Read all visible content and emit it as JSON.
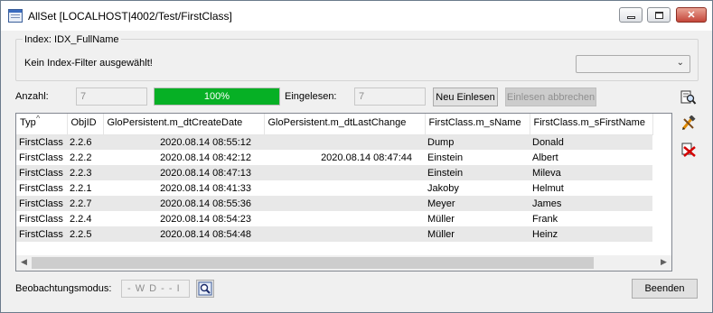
{
  "window": {
    "title": "AllSet [LOCALHOST|4002/Test/FirstClass]"
  },
  "index": {
    "legend": "Index: IDX_FullName",
    "filter_text": "Kein Index-Filter ausgewählt!",
    "combo_value": ""
  },
  "status": {
    "anzahl_label": "Anzahl:",
    "anzahl_value": "7",
    "progress_text": "100%",
    "progress_fraction": 1.0,
    "eingelesen_label": "Eingelesen:",
    "eingelesen_value": "7",
    "reload_button": "Neu Einlesen",
    "abort_button": "Einlesen abbrechen"
  },
  "grid": {
    "columns": [
      "Typ",
      "ObjID",
      "GloPersistent.m_dtCreateDate",
      "GloPersistent.m_dtLastChange",
      "FirstClass.m_sName",
      "FirstClass.m_sFirstName"
    ],
    "rows": [
      [
        "FirstClass",
        "2.2.6",
        "2020.08.14 08:55:12",
        "",
        "Dump",
        "Donald"
      ],
      [
        "FirstClass",
        "2.2.2",
        "2020.08.14 08:42:12",
        "2020.08.14 08:47:44",
        "Einstein",
        "Albert"
      ],
      [
        "FirstClass",
        "2.2.3",
        "2020.08.14 08:47:13",
        "",
        "Einstein",
        "Mileva"
      ],
      [
        "FirstClass",
        "2.2.1",
        "2020.08.14 08:41:33",
        "",
        "Jakoby",
        "Helmut"
      ],
      [
        "FirstClass",
        "2.2.7",
        "2020.08.14 08:55:36",
        "",
        "Meyer",
        "James"
      ],
      [
        "FirstClass",
        "2.2.4",
        "2020.08.14 08:54:23",
        "",
        "Müller",
        "Frank"
      ],
      [
        "FirstClass",
        "2.2.5",
        "2020.08.14 08:54:48",
        "",
        "Müller",
        "Heinz"
      ]
    ]
  },
  "footer": {
    "observe_label": "Beobachtungsmodus:",
    "observe_value": "- W D - - I",
    "close_button": "Beenden"
  },
  "icons": {
    "window": "table-window-icon",
    "search_side": "magnifier-document-icon",
    "edit_side": "pencil-hammer-icon",
    "delete_side": "delete-x-icon",
    "observe": "magnifier-icon"
  }
}
